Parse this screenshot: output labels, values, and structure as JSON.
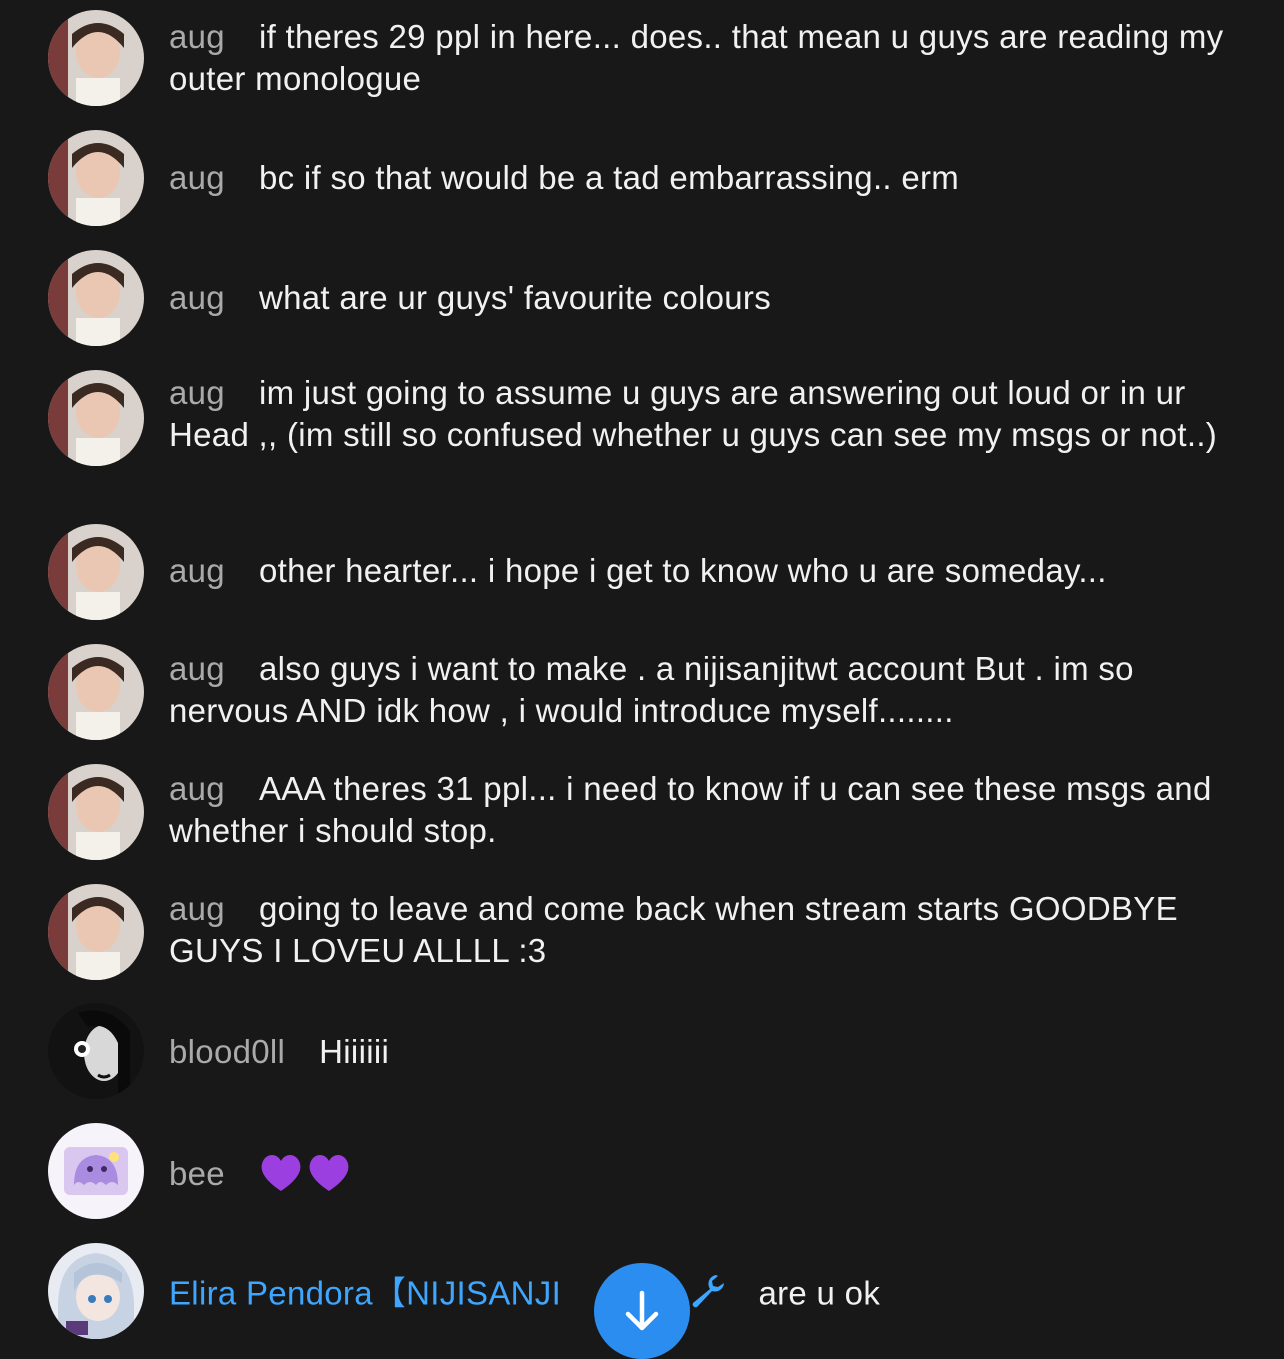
{
  "messages": [
    {
      "author": "aug",
      "text": "if theres 29 ppl in here... does.. that mean u guys are reading my outer monologue"
    },
    {
      "author": "aug",
      "text": "bc if so that would be a tad embarrassing.. erm"
    },
    {
      "author": "aug",
      "text": "what are ur guys' favourite colours"
    },
    {
      "author": "aug",
      "text": "im just going to assume u guys are answering out loud or in ur Head ,, (im still so confused whether u guys can see my msgs or not..)"
    },
    {
      "author": "aug",
      "text": "other hearter... i hope i get to know who u are someday..."
    },
    {
      "author": "aug",
      "text": "also guys i want to make . a nijisanjitwt account But . im so nervous AND idk how , i would introduce myself........"
    },
    {
      "author": "aug",
      "text": "AAA theres 31 ppl... i need to know if u can see these msgs and whether i should stop."
    },
    {
      "author": "aug",
      "text": "going to leave and come back when stream starts GOODBYE GUYS I LOVEU ALLLL :3"
    },
    {
      "author": "blood0ll",
      "text": "Hiiiiii"
    },
    {
      "author": "bee",
      "text": "",
      "emojis": [
        "purple-heart",
        "purple-heart"
      ]
    },
    {
      "author": "Elira Pendora【NIJISANJI",
      "text": "are u ok",
      "badges": [
        "verified-check-icon",
        "wrench-icon"
      ]
    }
  ],
  "colors": {
    "background": "#181818",
    "text": "#f1f1f1",
    "author": "#aaaaaa",
    "owner_author": "#3ea6ff",
    "scroll_button": "#2b8df0",
    "heart": "#9b3fe0"
  },
  "scroll_button": {
    "icon": "arrow-down-icon"
  }
}
